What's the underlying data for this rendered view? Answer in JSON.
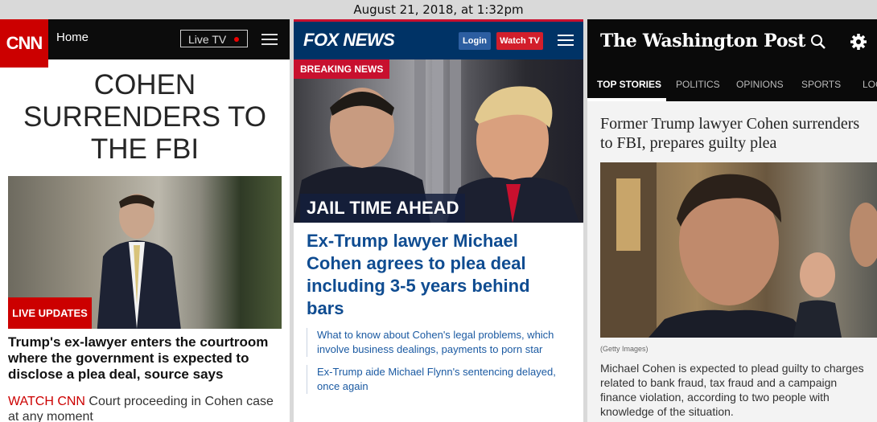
{
  "datetime": "August 21, 2018, at 1:32pm",
  "cnn": {
    "logo": "CNN",
    "home": "Home",
    "live_tv": "Live TV",
    "headline_lines": [
      "COHEN",
      "SURRENDERS TO",
      "THE FBI"
    ],
    "badge": "LIVE UPDATES",
    "subhead": "Trump's ex-lawyer enters the courtroom where the government is expected to disclose a plea deal, source says",
    "watch": "WATCH CNN",
    "watch_rest": " Court proceeding in Cohen case at any moment",
    "colors": {
      "brand": "#cc0000",
      "header": "#0c0c0c"
    }
  },
  "fox": {
    "logo": "FOX NEWS",
    "login": "Login",
    "watch_tv": "Watch TV",
    "breaking": "BREAKING NEWS",
    "overlay": "JAIL TIME AHEAD",
    "headline": "Ex-Trump lawyer Michael Cohen agrees to plea deal including 3-5 years behind bars",
    "links": [
      "What to know about Cohen's legal problems, which involve business dealings, payments to porn star",
      "Ex-Trump aide Michael Flynn's sentencing delayed, once again"
    ],
    "colors": {
      "header": "#003366",
      "accent": "#c8102e",
      "link": "#1b5aa2"
    }
  },
  "wapo": {
    "logo": "The Washington Post",
    "nav": [
      "TOP STORIES",
      "POLITICS",
      "OPINIONS",
      "SPORTS",
      "LOC"
    ],
    "headline": "Former Trump lawyer Cohen surrenders to FBI, prepares guilty plea",
    "credit": "(Getty Images)",
    "caption": "Michael Cohen is expected to plead guilty to charges related to bank fraud, tax fraud and a campaign finance violation, according to two people with knowledge of the situation."
  }
}
